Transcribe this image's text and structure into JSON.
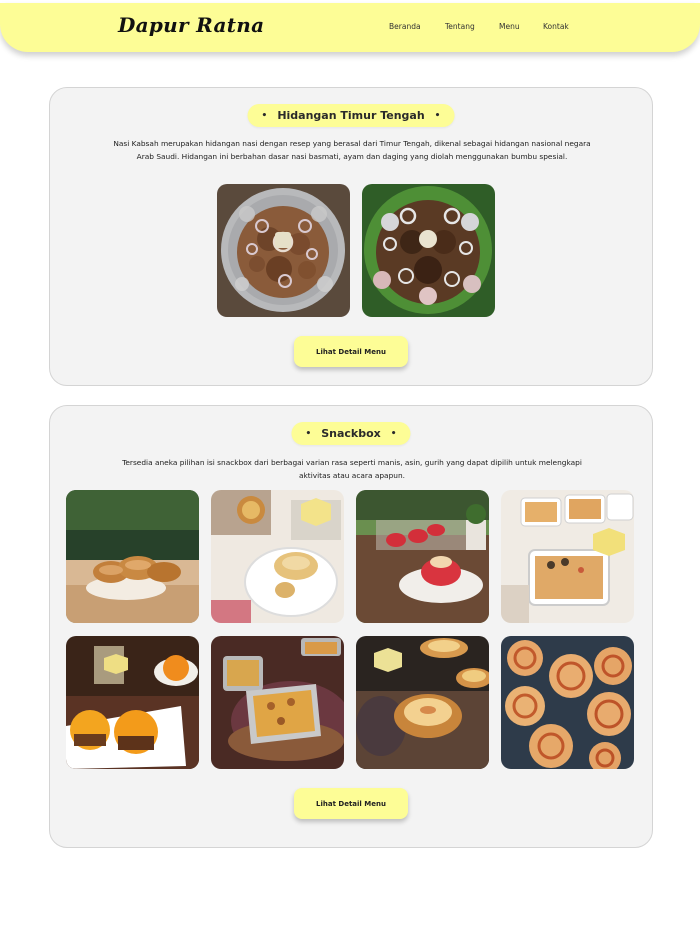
{
  "brand": {
    "logo_text": "Dapur Ratna"
  },
  "nav": {
    "items": [
      {
        "label": "Beranda"
      },
      {
        "label": "Tentang"
      },
      {
        "label": "Menu"
      },
      {
        "label": "Kontak"
      }
    ]
  },
  "theme": {
    "accent": "#fdfd96",
    "card_bg": "#f3f3f3",
    "text": "#1f1f1f"
  },
  "sections": [
    {
      "title": "Hidangan Timur Tengah",
      "bullet": "•",
      "description": "Nasi Kabsah merupakan hidangan nasi dengan resep yang berasal dari Timur Tengah, dikenal sebagai hidangan nasional negara Arab Saudi. Hidangan ini berbahan dasar nasi basmati, ayam dan daging yang diolah menggunakan bumbu spesial.",
      "button_label": "Lihat Detail Menu"
    },
    {
      "title": "Snackbox",
      "bullet": "•",
      "description": "Tersedia aneka pilihan isi snackbox dari berbagai varian rasa seperti manis, asin, gurih yang dapat dipilih untuk melengkapi aktivitas atau acara apapun.",
      "button_label": "Lihat Detail Menu"
    }
  ]
}
